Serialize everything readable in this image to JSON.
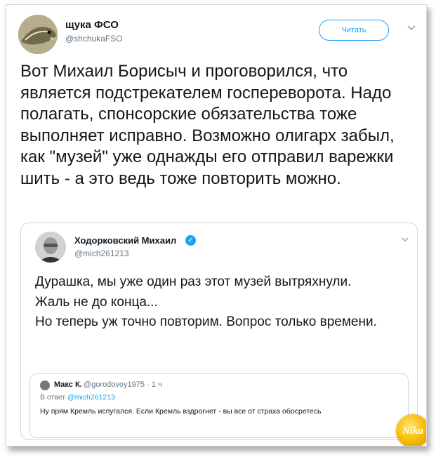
{
  "tweet": {
    "author_name": "щука ФСО",
    "author_handle": "@shchukaFSO",
    "follow_label": "Читать",
    "menu_icon": "chevron-down-icon",
    "text": "Вот Михаил Борисыч и проговорился, что является подстрекателем госпереворота. Надо полагать, спонсорские обязательства тоже выполняет исправно. Возможно олигарх забыл, как \"музей\" уже однажды его отправил варежки шить - а это ведь тоже повторить можно."
  },
  "quoted_tweet": {
    "author_name": "Ходорковский Михаил",
    "verified_icon": "verified-check-icon",
    "author_handle": "@mich261213",
    "menu_icon": "chevron-down-icon",
    "text_line1": "Дурашка, мы уже один раз этот музей вытряхнули.",
    "text_line2": "Жаль не до конца...",
    "text_line3": "Но теперь уж точно повторим. Вопрос только времени.",
    "reply": {
      "author_name": "Макс К.",
      "author_handle_time": "@gorodovoy1975 · 1 ч",
      "reply_prefix": "В ответ",
      "reply_to": "@mich261213",
      "text": "Ну прям Кремль испугался. Если Кремль вздрогнет - вы все от страха обосретесь"
    }
  },
  "watermark": {
    "logo": "Nika logo"
  },
  "colors": {
    "accent": "#1da1f2",
    "muted": "#657786",
    "border": "#ccd6dd"
  }
}
